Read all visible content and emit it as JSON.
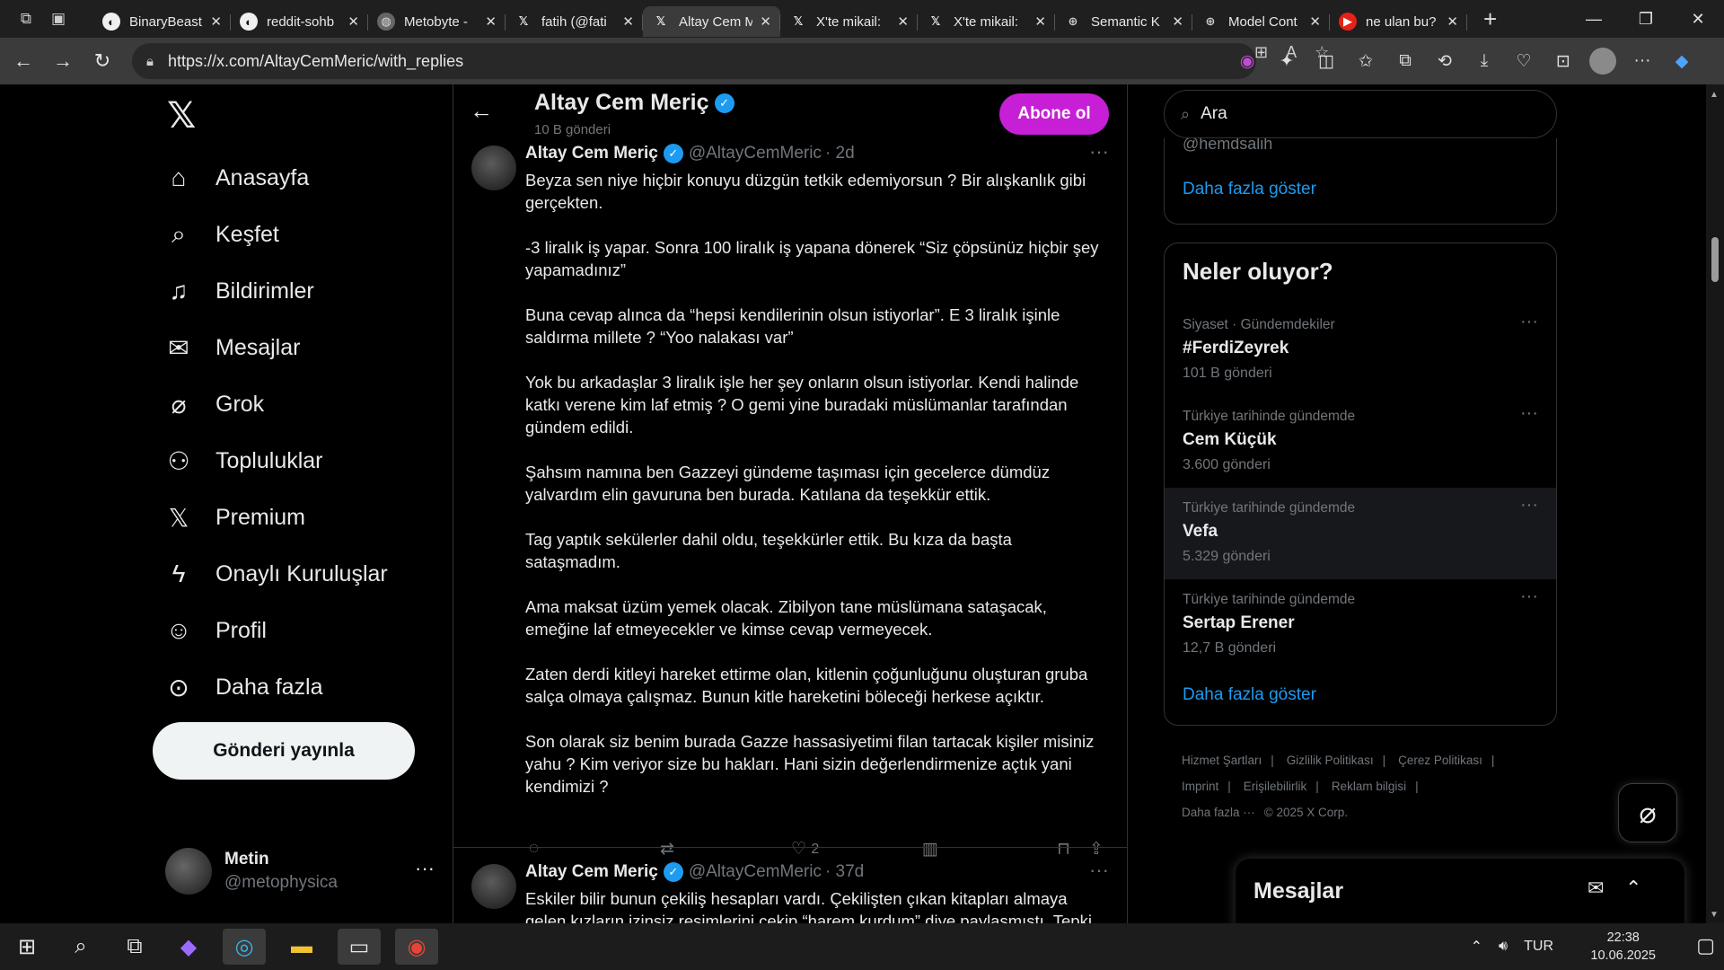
{
  "browser": {
    "tabs": [
      {
        "title": "BinaryBeast",
        "favicon": "github-icon",
        "active": false
      },
      {
        "title": "reddit-sohb",
        "favicon": "github-icon",
        "active": false
      },
      {
        "title": "Metobyte -",
        "favicon": "forum-icon",
        "active": false
      },
      {
        "title": "fatih (@fati",
        "favicon": "x-icon",
        "active": false
      },
      {
        "title": "Altay Cem M",
        "favicon": "x-icon",
        "active": true
      },
      {
        "title": "X'te mikail:",
        "favicon": "x-icon",
        "active": false
      },
      {
        "title": "X'te mikail:",
        "favicon": "x-icon",
        "active": false
      },
      {
        "title": "Semantic K",
        "favicon": "globe-icon",
        "active": false
      },
      {
        "title": "Model Cont",
        "favicon": "globe-icon",
        "active": false
      },
      {
        "title": "ne ulan bu?",
        "favicon": "youtube-icon",
        "active": false
      }
    ],
    "url": "https://x.com/AltayCemMeric/with_replies"
  },
  "left_nav": {
    "items": [
      {
        "label": "Anasayfa",
        "icon": "home-icon"
      },
      {
        "label": "Keşfet",
        "icon": "search-icon"
      },
      {
        "label": "Bildirimler",
        "icon": "bell-icon"
      },
      {
        "label": "Mesajlar",
        "icon": "mail-icon"
      },
      {
        "label": "Grok",
        "icon": "grok-icon"
      },
      {
        "label": "Topluluklar",
        "icon": "communities-icon"
      },
      {
        "label": "Premium",
        "icon": "x-premium-icon"
      },
      {
        "label": "Onaylı Kuruluşlar",
        "icon": "lightning-icon"
      },
      {
        "label": "Profil",
        "icon": "person-icon"
      },
      {
        "label": "Daha fazla",
        "icon": "more-circle-icon"
      }
    ],
    "post_button": "Gönderi yayınla",
    "account": {
      "name": "Metin",
      "handle": "@metophysica"
    }
  },
  "header": {
    "name": "Altay Cem Meriç",
    "post_count": "10 B gönderi",
    "subscribe": "Abone ol"
  },
  "tweet1": {
    "name": "Altay Cem Meriç",
    "handle": "@AltayCemMeric",
    "time": "· 2d",
    "paragraphs": [
      "Beyza sen niye hiçbir konuyu düzgün tetkik edemiyorsun ? Bir alışkanlık gibi gerçekten.",
      "-3 liralık iş yapar. Sonra 100 liralık iş yapana dönerek “Siz çöpsünüz hiçbir şey yapamadınız”",
      "Buna cevap alınca da “hepsi kendilerinin olsun istiyorlar”. E 3 liralık işinle saldırma millete ? “Yoo nalakası var”",
      "Yok bu arkadaşlar 3 liralık işle her şey onların olsun istiyorlar. Kendi halinde katkı verene kim laf etmiş ? O gemi yine buradaki müslümanlar tarafından gündem edildi.",
      "Şahsım namına ben Gazzeyi gündeme taşıması için gecelerce dümdüz yalvardım elin gavuruna ben burada. Katılana da teşekkür ettik.",
      "Tag yaptık sekülerler dahil oldu, teşekkürler ettik. Bu kıza da başta sataşmadım.",
      "Ama maksat üzüm yemek olacak. Zibilyon tane müslümana sataşacak, emeğine laf etmeyecekler ve kimse cevap vermeyecek.",
      "Zaten derdi kitleyi hareket ettirme olan, kitlenin çoğunluğunu oluşturan gruba salça olmaya çalışmaz. Bunun kitle hareketini böleceği herkese açıktır.",
      "Son olarak siz benim burada Gazze hassasiyetimi filan tartacak kişiler misiniz yahu ? Kim veriyor size bu hakları. Hani sizin değerlendirmenize açtık yani kendimizi ?"
    ],
    "likes": "2"
  },
  "tweet2": {
    "name": "Altay Cem Meriç",
    "handle": "@AltayCemMeric",
    "time": "· 37d",
    "text": "Eskiler bilir bunun çekiliş hesapları vardı. Çekilişten çıkan kitapları almaya gelen kızların izinsiz resimlerini çekip “harem kurdum” diye paylaşmıştı. Tepki çekince"
  },
  "right": {
    "search_placeholder": "Ara",
    "partial_handle": "@hemdsalih",
    "show_more": "Daha fazla göster",
    "trends_title": "Neler oluyor?",
    "trends": [
      {
        "category": "Siyaset · Gündemdekiler",
        "name": "#FerdiZeyrek",
        "count": "101 B gönderi"
      },
      {
        "category": "Türkiye tarihinde gündemde",
        "name": "Cem Küçük",
        "count": "3.600 gönderi"
      },
      {
        "category": "Türkiye tarihinde gündemde",
        "name": "Vefa",
        "count": "5.329 gönderi"
      },
      {
        "category": "Türkiye tarihinde gündemde",
        "name": "Sertap Erener",
        "count": "12,7 B gönderi"
      }
    ],
    "show_more2": "Daha fazla göster",
    "footer": [
      "Hizmet Şartları",
      "Gizlilik Politikası",
      "Çerez Politikası",
      "Imprint",
      "Erişilebilirlik",
      "Reklam bilgisi",
      "Daha fazla ···",
      "© 2025 X Corp."
    ],
    "messages_title": "Mesajlar"
  },
  "taskbar": {
    "language": "TUR",
    "time": "22:38",
    "date": "10.06.2025"
  }
}
